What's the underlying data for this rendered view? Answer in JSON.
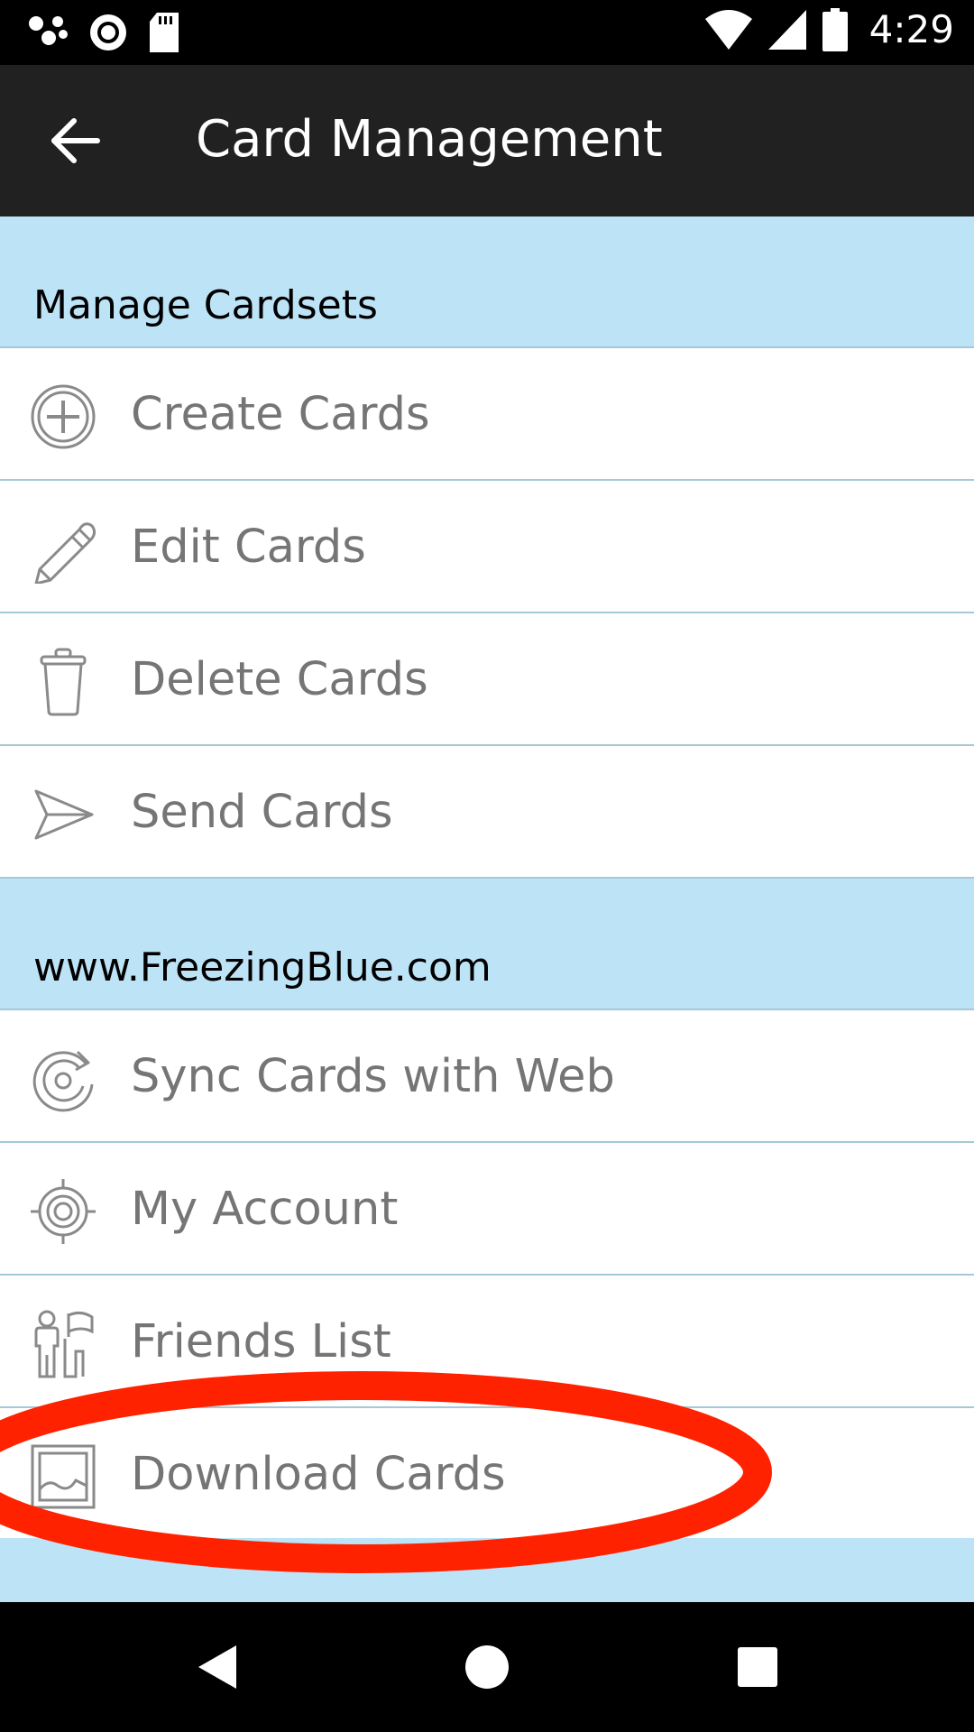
{
  "status_bar": {
    "time": "4:29",
    "icons": [
      "notification-dots-icon",
      "record-icon",
      "sd-card-icon",
      "wifi-icon",
      "cell-signal-icon",
      "battery-icon"
    ]
  },
  "app_bar": {
    "title": "Card Management",
    "back_icon": "arrow-back-icon"
  },
  "sections": [
    {
      "header": "Manage Cardsets",
      "items": [
        {
          "label": "Create Cards",
          "icon": "plus-circle-icon"
        },
        {
          "label": "Edit Cards",
          "icon": "pencil-icon"
        },
        {
          "label": "Delete Cards",
          "icon": "trash-icon"
        },
        {
          "label": "Send Cards",
          "icon": "paper-plane-icon"
        }
      ]
    },
    {
      "header": "www.FreezingBlue.com",
      "items": [
        {
          "label": "Sync Cards with Web",
          "icon": "sync-icon"
        },
        {
          "label": "My Account",
          "icon": "target-icon"
        },
        {
          "label": "Friends List",
          "icon": "friends-icon"
        },
        {
          "label": "Download Cards",
          "icon": "image-icon"
        }
      ]
    }
  ],
  "annotation": {
    "type": "red-ellipse",
    "target": "Download Cards",
    "color": "#ff2200"
  },
  "colors": {
    "status_bar": "#000000",
    "app_bar": "#212121",
    "section_header": "#bde3f6",
    "divider": "#a7c8d7",
    "label_text": "#757575",
    "icon_stroke": "#8a8a8a"
  },
  "nav_bar": {
    "icons": [
      "nav-back-icon",
      "nav-home-icon",
      "nav-recents-icon"
    ]
  }
}
